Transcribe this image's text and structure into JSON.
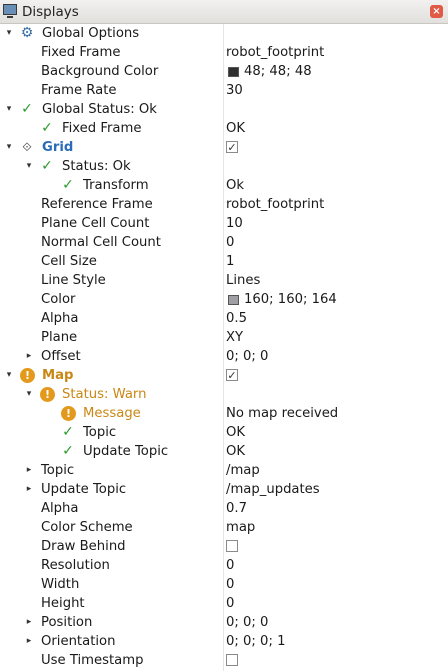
{
  "panel": {
    "title": "Displays"
  },
  "colors": {
    "bg_swatch": "#303030",
    "grid_swatch": "#a0a0a4",
    "ok_green": "#2c9a2c",
    "warn_orange": "#e39a1c",
    "grid_blue": "#2b6cb8"
  },
  "global_options": {
    "label": "Global Options",
    "fixed_frame": {
      "label": "Fixed Frame",
      "value": "robot_footprint"
    },
    "background_color": {
      "label": "Background Color",
      "value": "48; 48; 48"
    },
    "frame_rate": {
      "label": "Frame Rate",
      "value": "30"
    }
  },
  "global_status": {
    "label": "Global Status: Ok",
    "fixed_frame": {
      "label": "Fixed Frame",
      "value": "OK"
    }
  },
  "grid": {
    "label": "Grid",
    "enabled": true,
    "status": {
      "label": "Status: Ok",
      "transform": {
        "label": "Transform",
        "value": "Ok"
      }
    },
    "reference_frame": {
      "label": "Reference Frame",
      "value": "robot_footprint"
    },
    "plane_cell_count": {
      "label": "Plane Cell Count",
      "value": "10"
    },
    "normal_cell_count": {
      "label": "Normal Cell Count",
      "value": "0"
    },
    "cell_size": {
      "label": "Cell Size",
      "value": "1"
    },
    "line_style": {
      "label": "Line Style",
      "value": "Lines"
    },
    "color": {
      "label": "Color",
      "value": "160; 160; 164"
    },
    "alpha": {
      "label": "Alpha",
      "value": "0.5"
    },
    "plane": {
      "label": "Plane",
      "value": "XY"
    },
    "offset": {
      "label": "Offset",
      "value": "0; 0; 0"
    }
  },
  "map": {
    "label": "Map",
    "enabled": true,
    "status": {
      "label": "Status: Warn",
      "message": {
        "label": "Message",
        "value": "No map received"
      },
      "topic": {
        "label": "Topic",
        "value": "OK"
      },
      "update_topic": {
        "label": "Update Topic",
        "value": "OK"
      }
    },
    "topic": {
      "label": "Topic",
      "value": "/map"
    },
    "update_topic": {
      "label": "Update Topic",
      "value": "/map_updates"
    },
    "alpha": {
      "label": "Alpha",
      "value": "0.7"
    },
    "color_scheme": {
      "label": "Color Scheme",
      "value": "map"
    },
    "draw_behind": {
      "label": "Draw Behind",
      "checked": false
    },
    "resolution": {
      "label": "Resolution",
      "value": "0"
    },
    "width": {
      "label": "Width",
      "value": "0"
    },
    "height": {
      "label": "Height",
      "value": "0"
    },
    "position": {
      "label": "Position",
      "value": "0; 0; 0"
    },
    "orientation": {
      "label": "Orientation",
      "value": "0; 0; 0; 1"
    },
    "use_timestamp": {
      "label": "Use Timestamp",
      "checked": false
    }
  },
  "icons": {
    "panel": "monitor-icon",
    "close": "close-icon",
    "options": "gear-icon",
    "grid": "grid-icon",
    "ok": "checkmark-icon",
    "warn": "warning-icon"
  }
}
